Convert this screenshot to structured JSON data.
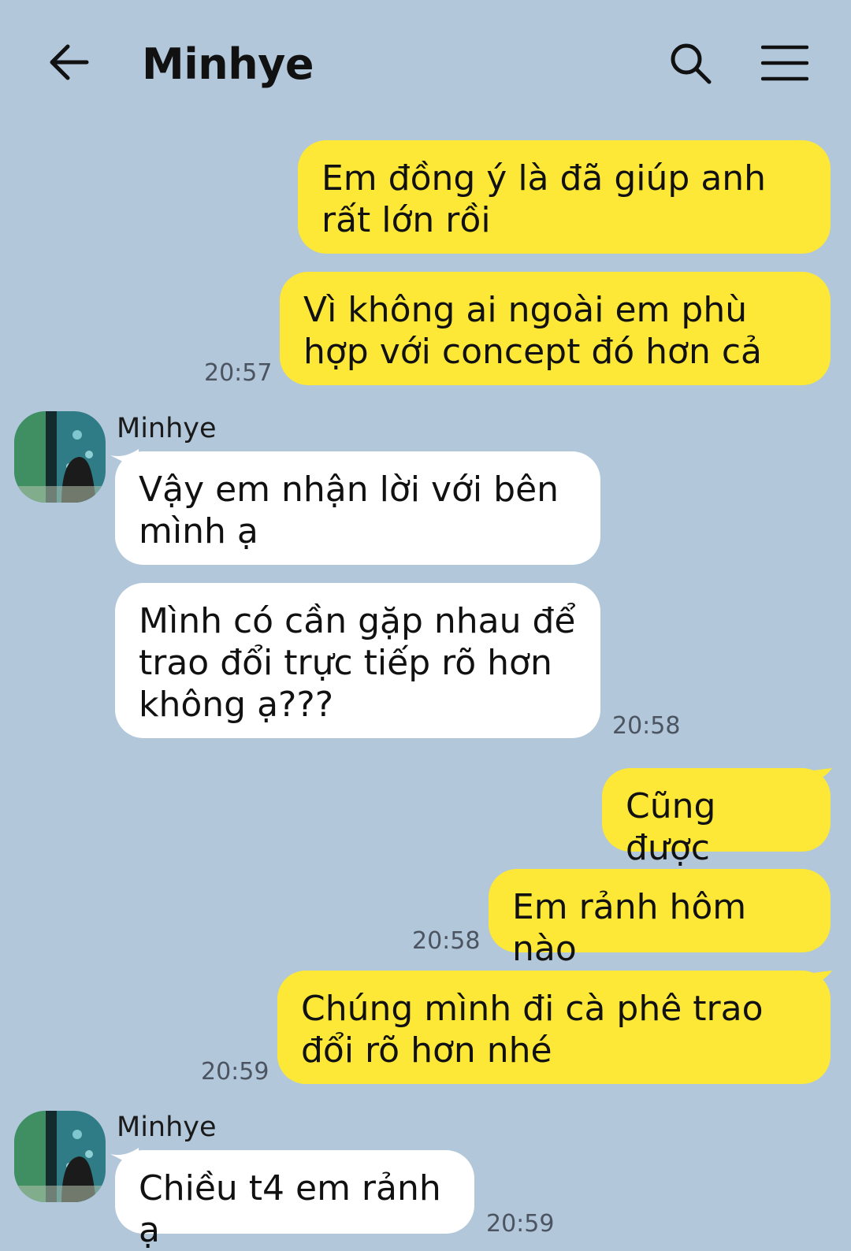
{
  "header": {
    "title": "Minhye",
    "icons": {
      "back": "arrow-left-icon",
      "search": "search-icon",
      "menu": "hamburger-menu-icon"
    }
  },
  "colors": {
    "background": "#b2c7da",
    "my_bubble": "#fde837",
    "their_bubble": "#ffffff",
    "timestamp": "#4b5460"
  },
  "messages": [
    {
      "from": "me",
      "text": "Em đồng ý là đã giúp anh rất lớn rồi",
      "time": ""
    },
    {
      "from": "me",
      "text": "Vì không ai ngoài em phù hợp với concept đó hơn cả",
      "time": "20:57"
    },
    {
      "from": "them",
      "sender": "Minhye",
      "text": "Vậy em nhận lời với bên mình ạ",
      "time": ""
    },
    {
      "from": "them",
      "text": "Mình có cần gặp nhau để trao đổi trực tiếp rõ hơn không ạ???",
      "time": "20:58"
    },
    {
      "from": "me",
      "text": "Cũng được",
      "time": ""
    },
    {
      "from": "me",
      "text": "Em rảnh hôm nào",
      "time": "20:58"
    },
    {
      "from": "me",
      "text": "Chúng mình đi cà phê trao đổi rõ hơn nhé",
      "time": "20:59"
    },
    {
      "from": "them",
      "sender": "Minhye",
      "text": "Chiều t4 em rảnh ạ",
      "time": "20:59"
    }
  ]
}
